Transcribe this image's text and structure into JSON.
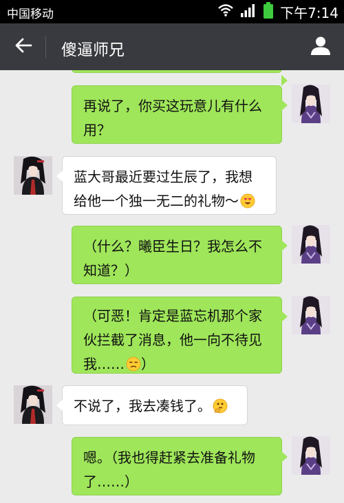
{
  "status_bar": {
    "carrier": "中国移动",
    "time": "下午7:14"
  },
  "header": {
    "title": "傻逼师兄",
    "back_icon": "back-arrow-icon",
    "profile_icon": "user-profile-icon"
  },
  "messages": [
    {
      "side": "out",
      "lines": [
        "再说了，你买这玩意儿有什么",
        "用？"
      ]
    },
    {
      "side": "in",
      "lines": [
        "蓝大哥最近要过生辰了，我想",
        "给他一个独一无二的礼物～"
      ],
      "emoji": "heart-eyes-emoji"
    },
    {
      "side": "out",
      "lines": [
        "（什么？曦臣生日？我怎么不",
        "知道？）"
      ]
    },
    {
      "side": "out",
      "lines": [
        "（可恶！肯定是蓝忘机那个家",
        "伙拦截了消息，他一向不待见",
        "我……"
      ],
      "end_text": "）",
      "emoji": "unamused-emoji"
    },
    {
      "side": "in",
      "lines": [
        "不说了，我去凑钱了。"
      ],
      "emoji": "thinking-emoji"
    },
    {
      "side": "out",
      "lines": [
        "嗯。（我也得赶紧去准备礼物",
        "了……）"
      ]
    }
  ],
  "colors": {
    "outgoing_bubble": "#9fe65a",
    "incoming_bubble": "#ffffff",
    "chat_background": "#ebebeb",
    "header_background": "#393a3f"
  }
}
